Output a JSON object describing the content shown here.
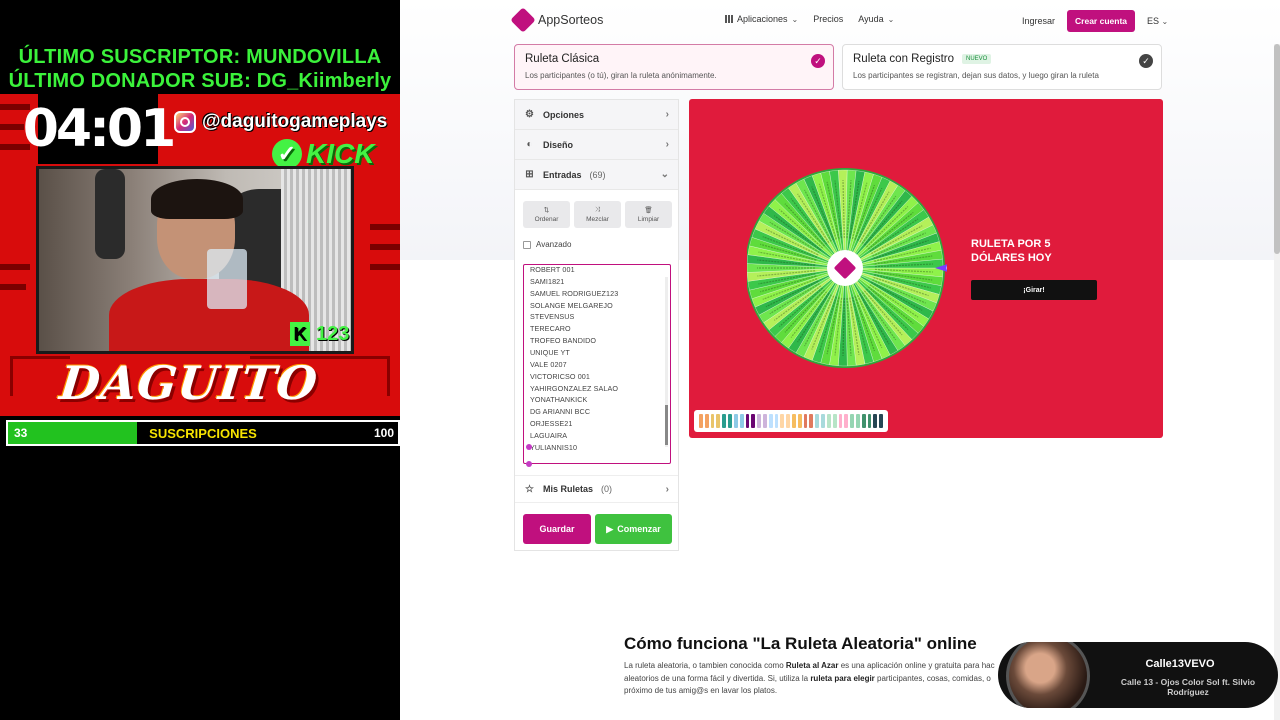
{
  "overlay": {
    "last_subscriber": "ÚLTIMO SUSCRIPTOR: MUNDOVILLA",
    "last_donor": "ÚLTIMO DONADOR SUB: DG_Kiimberly",
    "timer": "04:01",
    "instagram": "@daguitogameplays",
    "kick_label": "KICK",
    "kick_count": "123",
    "streamer_name": "DAGUITO",
    "sub_goal": {
      "current": "33",
      "label": "SUSCRIPCIONES",
      "max": "100",
      "progress": 0.33
    },
    "colors": {
      "frame": "#d80c0c",
      "accent_green": "#3bf23b"
    }
  },
  "nav": {
    "brand": "AppSorteos",
    "menu": [
      {
        "label": "Aplicaciones",
        "icon": "grid-icon",
        "dropdown": true
      },
      {
        "label": "Precios",
        "dropdown": false
      },
      {
        "label": "Ayuda",
        "dropdown": true
      }
    ],
    "login": "Ingresar",
    "create_account": "Crear cuenta",
    "language": "ES"
  },
  "modes": [
    {
      "title": "Ruleta Clásica",
      "desc": "Los participantes (o tú), giran la ruleta anónimamente.",
      "active": true
    },
    {
      "title": "Ruleta con Registro",
      "badge": "NUEVO",
      "desc": "Los participantes se registran, dejan sus datos, y luego giran la ruleta",
      "active": false
    }
  ],
  "sidebar": {
    "options": "Opciones",
    "design": "Diseño",
    "entries_label": "Entradas",
    "entries_count": "(69)",
    "tools": {
      "order": "Ordenar",
      "shuffle": "Mezclar",
      "clear": "Limpiar"
    },
    "advanced": "Avanzado",
    "entries": [
      "ROBERT 001",
      "SAMI1821",
      "SAMUEL RODRIGUEZ123",
      "SOLANGE MELGAREJO",
      "STEVENSUS",
      "TERECARO",
      "TROFEO BANDIDO",
      "UNIQUE YT",
      "VALE 0207",
      "VICTORICSO 001",
      "YAHIRGONZALEZ SALAO",
      "YONATHANKICK",
      "DG ARIANNI BCC",
      "ORJESSE21",
      "LAGUAIRA",
      "YULIANNIS10"
    ],
    "my_wheels": "Mis Ruletas",
    "my_wheels_count": "(0)",
    "save": "Guardar",
    "start": "Comenzar"
  },
  "wheel": {
    "prize": "RULETA POR 5 DÓLARES HOY",
    "spin_button": "¡Girar!",
    "background": "#e01b3c",
    "segment_colors": [
      "#8ff24a",
      "#5fdc3c",
      "#3cc84a",
      "#b4f05a",
      "#6ee64e",
      "#2fb84a"
    ],
    "segment_count": 69,
    "palette_colors": [
      "#f4a261",
      "#e9c46a",
      "#2a9d8f",
      "#8ecae6",
      "#6a0572",
      "#cdb4db",
      "#bde0fe",
      "#ffd6a5",
      "#f6bd60",
      "#e07a5f",
      "#a8dadc",
      "#b7e4c7",
      "#ffafcc",
      "#95d5b2",
      "#40916c",
      "#264653"
    ]
  },
  "howto": {
    "title": "Cómo funciona \"La Ruleta Aleatoria\" online",
    "line1_a": "La ruleta aleatoria, o tambien conocida como ",
    "line1_b": "Ruleta al Azar",
    "line1_c": " es una aplicación online y gratuita para hac",
    "line2": "aleatorios de una forma fácil y divertida. Si, utiliza la ",
    "line2_b": "ruleta para elegir",
    "line2_c": " participantes, cosas, comidas, o",
    "line3": "próximo de tus amig@s en lavar los platos."
  },
  "now_playing": {
    "channel": "Calle13VEVO",
    "song": "Calle 13 - Ojos Color Sol ft. Silvio Rodríguez"
  }
}
